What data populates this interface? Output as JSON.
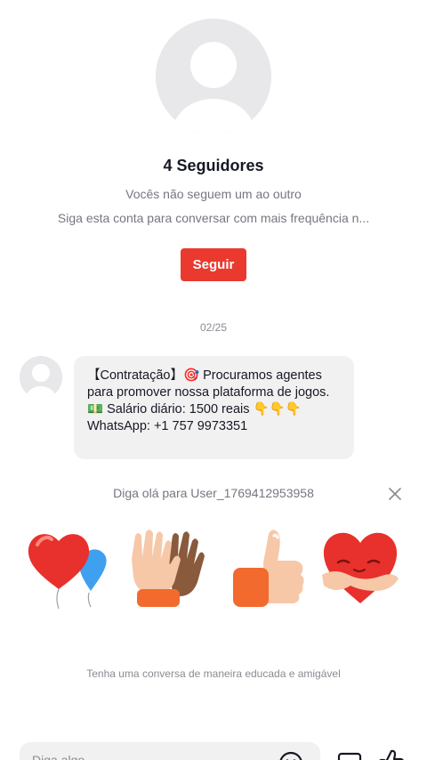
{
  "profile": {
    "followers_label": "4 Seguidores",
    "relationship_text": "Vocês não seguem um ao outro",
    "hint_text": "Siga esta conta para conversar com mais frequência n...",
    "follow_button": "Seguir"
  },
  "messages": {
    "date_separator": "02/25",
    "items": [
      {
        "text": "【Contratação】🎯 Procuramos agentes para promover nossa plataforma de jogos. 💵 Salário diário: 1500 reais 👇👇👇 WhatsApp: +1 757 9973351"
      }
    ]
  },
  "greeting": {
    "text": "Diga olá para User_1769412953958",
    "close_icon": "close-icon",
    "stickers": [
      "heart-balloons-sticker",
      "high-five-hands-sticker",
      "thumbs-up-sticker",
      "heart-hug-sticker"
    ]
  },
  "notice": {
    "text": "Tenha uma conversa de maneira educada e amigável"
  },
  "composer": {
    "placeholder": "Diga algo",
    "icons": [
      "emoji-icon",
      "image-icon",
      "thumbs-up-icon"
    ]
  },
  "colors": {
    "accent": "#ea3a2f",
    "bubble_bg": "#f1f1f2",
    "secondary_text": "#757780"
  }
}
